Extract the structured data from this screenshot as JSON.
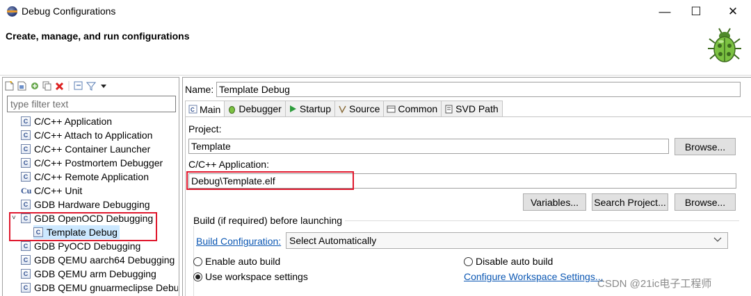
{
  "window": {
    "title": "Debug Configurations",
    "minimize": "—",
    "maximize": "☐",
    "close": "✕"
  },
  "header": {
    "title": "Create, manage, and run configurations"
  },
  "left": {
    "filter_placeholder": "type filter text",
    "items": [
      {
        "label": "C/C++ Application"
      },
      {
        "label": "C/C++ Attach to Application"
      },
      {
        "label": "C/C++ Container Launcher"
      },
      {
        "label": "C/C++ Postmortem Debugger"
      },
      {
        "label": "C/C++ Remote Application"
      },
      {
        "label": "C/C++ Unit"
      },
      {
        "label": "GDB Hardware Debugging"
      },
      {
        "label": "GDB OpenOCD Debugging"
      },
      {
        "label": "Template Debug"
      },
      {
        "label": "GDB PyOCD Debugging"
      },
      {
        "label": "GDB QEMU aarch64 Debugging"
      },
      {
        "label": "GDB QEMU arm Debugging"
      },
      {
        "label": "GDB QEMU gnuarmeclipse Debu"
      }
    ],
    "twist_expanded": "˅"
  },
  "right": {
    "name_label": "Name:",
    "name_value": "Template Debug",
    "tabs": [
      {
        "label": "Main"
      },
      {
        "label": "Debugger"
      },
      {
        "label": "Startup"
      },
      {
        "label": "Source"
      },
      {
        "label": "Common"
      },
      {
        "label": "SVD Path"
      }
    ],
    "project_label": "Project:",
    "project_value": "Template",
    "browse_label": "Browse...",
    "app_label": "C/C++ Application:",
    "app_value": "Debug\\Template.elf",
    "variables_label": "Variables...",
    "search_project_label": "Search Project...",
    "build_group_label": "Build (if required) before launching",
    "build_config_link": "Build Configuration:",
    "build_config_value": "Select Automatically",
    "enable_auto_build": "Enable auto build",
    "disable_auto_build": "Disable auto build",
    "use_workspace": "Use workspace settings",
    "configure_workspace": "Configure Workspace Settings..."
  },
  "watermark": "CSDN @21ic电子工程师",
  "colors": {
    "highlight_box": "#e0182d",
    "selection": "#cce8ff",
    "link": "#0b57b3"
  }
}
